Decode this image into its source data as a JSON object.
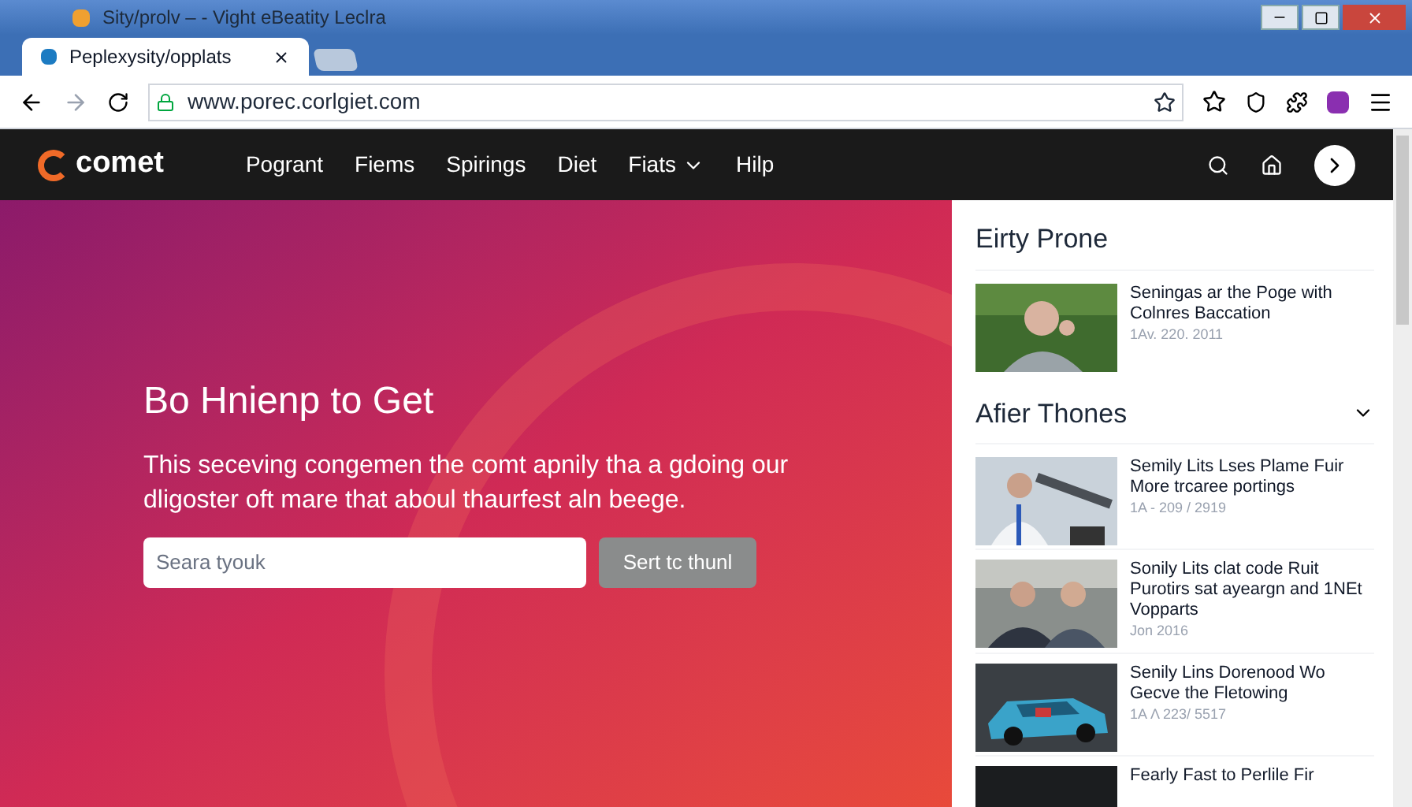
{
  "window": {
    "title": "Sity/prolv – - Vight eBeatity Leclra"
  },
  "tabs": [
    {
      "label": "Peplexysity/opplats",
      "selected": true
    }
  ],
  "address_bar": {
    "url": "www.porec.corlgiet.com"
  },
  "site_nav": {
    "logo": "comet",
    "items": [
      {
        "label": "Pogrant",
        "dropdown": false
      },
      {
        "label": "Fiems",
        "dropdown": false
      },
      {
        "label": "Spirings",
        "dropdown": false
      },
      {
        "label": "Diet",
        "dropdown": false
      },
      {
        "label": "Fiats",
        "dropdown": true
      },
      {
        "label": "Hilp",
        "dropdown": false
      }
    ]
  },
  "hero": {
    "heading": "Bo Hnienp to Get",
    "text": "This seceving congemen the comt apnily tha a gdoing our dligoster oft mare that aboul thaurfest aln beege.",
    "search": {
      "placeholder": "Seara tyouk"
    },
    "button": "Sert tc thunl"
  },
  "sidebar": {
    "sections": [
      {
        "title": "Eirty Prone",
        "collapsible": false,
        "articles": [
          {
            "title": "Seningas ar the Poge with Colnres Baccation",
            "date": "1Av. 220. 2011"
          }
        ]
      },
      {
        "title": "Afier Thones",
        "collapsible": true,
        "articles": [
          {
            "title": "Semily Lits Lses Plame Fuir More trcaree portings",
            "date": "1A - 209 / 2919"
          },
          {
            "title": "Sonily Lits clat code Ruit Purotirs sat ayeargn and 1NEt Vopparts",
            "date": "Jon 2016"
          },
          {
            "title": "Senily Lins Dorenood Wo Gecve the Fletowing",
            "date": "1A Λ 223/ 5517"
          },
          {
            "title": "Fearly Fast to Perlile Fir"
          }
        ]
      }
    ]
  }
}
